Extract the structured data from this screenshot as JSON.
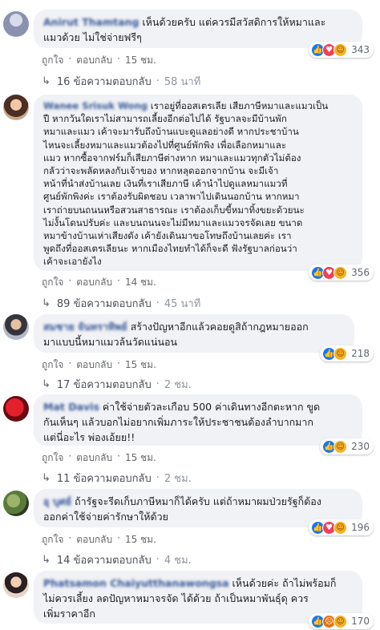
{
  "comments": [
    {
      "author": "Anirut Thamtang",
      "text": "เห็นด้วยครับ แต่ควรมีสวัสดิการให้หมาและ\nแมวด้วย ไม่ใช่จ่ายฟรีๆ",
      "like": "ถูกใจ",
      "reply": "ตอบกลับ",
      "time": "15 ชม.",
      "reaction_count": "343",
      "replies": "16 ข้อความตอบกลับ",
      "replies_time": "58 นาที"
    },
    {
      "author": "Wanee Srisuk Wong",
      "text": "เราอยู่ที่ออสเตรเลีย เสียภาษีหมาและแมวเป็น\nปี หากวันใดเราไม่สามารถเลี้ยงอีกต่อไปได้ รัฐบาลจะมีบ้านพัก\nหมาและแมว เค้าจะมารับถึงบ้านแบะดูแลอย่างดี หากประชาบ้าน\nไหนจะเลี้ยงหมาและแมวต้องไปที่ศูนย์พักพิง เพื่อเลือกหมาและ\nแมว หากซื้อจากฟร์มก็เสียภาษีต่างหาก หมาและแมวทุกตัวไม่ต้อง\nกลัวว่าจะพลัดหลงกับเจ้าของ หากหลุดออกจากบ้าน จะมีเจ้า\nหน้าที่นำส่งบ้านเลย เงินที่เราเสียภาษี เค้านำไปดูแลหมาแมวที่\nศูนย์พักพิงค่ะ เราต้องรับผิดชอบ เวลาพาไปเดินนอกบ้าน หากหมา\nเราถ่ายบนถนนหรือสวนสาธารณะ เราต้องเก็บขี้หมาทิ้งขยะด้วยนะ\nไม่งั้นโดนปรับค่ะ และบนถนนจะไม่มีหมาและแมวจรจัดเลย ขนาด\nหมาข้างบ้านเห่าเสียงดัง เค้ายังเดินมาขอโทษถึงบ้านเลยค่ะ เรา\nพูดถึงที่ออสเตรเลียนะ หากเมืองไทยทำได้ก็จะดี ฟังรัฐบาลก่อนว่า\nเค้าจะเอายังไง",
      "like": "ถูกใจ",
      "reply": "ตอบกลับ",
      "time": "14 ชม.",
      "reaction_count": "356",
      "replies": "89 ข้อความตอบกลับ",
      "replies_time": "45 นาที"
    },
    {
      "author": "สมชาย จันทราทิพย์",
      "text": "สร้างปัญหาอีกแล้วคอยดูสิถ้ากฎหมายออก\nมาแบบนี้หมาแมวล้นวัดแน่นอน",
      "like": "ถูกใจ",
      "reply": "ตอบกลับ",
      "time": "15 ชม.",
      "reaction_count": "218",
      "replies": "17 ข้อความตอบกลับ",
      "replies_time": "2 ชม."
    },
    {
      "author": "Mat Davis",
      "text": "ค่าใช้จ่ายตัวละเกือบ 500 ค่าเดินทางอีกตะหาก ขูด\nกันเห็นๆ แล้วบอกไม่อยากเพิ่มภาระให้ประชาชนต้องลำบากมาก\nแต่นี่อะไร พ่องเอ้ยย!!",
      "like": "ถูกใจ",
      "reply": "ตอบกลับ",
      "time": "15 ชม.",
      "reaction_count": "230",
      "replies": "11 ข้อความตอบกลับ",
      "replies_time": "2 ชม."
    },
    {
      "author": "อุ บุศย์",
      "text": "ถ้ารัฐจะรีดเก็บภาษีหมาก็ได้ครับ แต่ถ้าหมาผมป่วยรัฐก็ต้อง\nออกค่าใช้จ่ายค่ารักษาให้ด้วย",
      "like": "ถูกใจ",
      "reply": "ตอบกลับ",
      "time": "15 ชม.",
      "reaction_count": "196",
      "replies": "14 ข้อความตอบกลับ",
      "replies_time": "4 ชม."
    },
    {
      "author": "Phatsamon Chaiyutthanawongsa",
      "text": "เห็นด้วยค่ะ ถ้าไม่พร้อมก็\nไม่ควรเลี้ยง ลดปัญหาหมาจรจัด ได้ด้วย ถ้าเป็นหมาพันธุ์ดุ ควร\nเพิ่มราคาอีก",
      "like": "ถูกใจ",
      "reply": "ตอบกลับ",
      "time": "",
      "reaction_count": "170",
      "replies": "",
      "replies_time": ""
    }
  ],
  "ui": {
    "dot": "·",
    "reply_arrow": "↳"
  }
}
